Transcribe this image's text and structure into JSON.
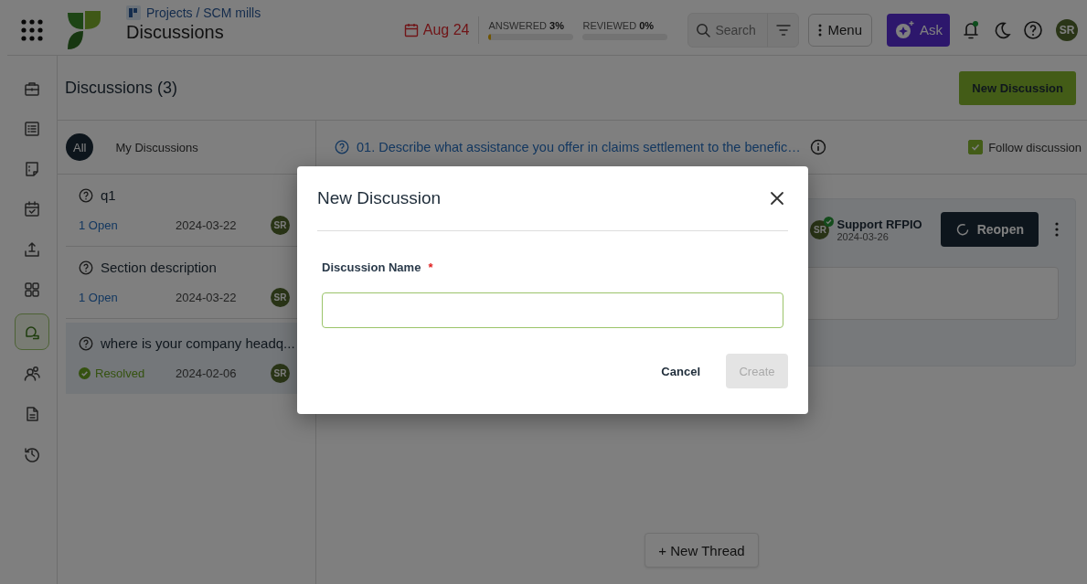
{
  "header": {
    "breadcrumb": "Projects / SCM mills",
    "title": "Discussions",
    "due": "Aug 24",
    "progress": [
      {
        "label": "ANSWERED",
        "value": "3%",
        "level": 0.03
      },
      {
        "label": "REVIEWED",
        "value": "0%",
        "level": 0
      }
    ],
    "search": {
      "placeholder": "Search"
    },
    "menu": "Menu",
    "ask": "Ask",
    "avatar": "SR"
  },
  "nav": [
    {
      "kind": "briefcase",
      "selected": false
    },
    {
      "kind": "list",
      "selected": false
    },
    {
      "kind": "note",
      "selected": false
    },
    {
      "kind": "calendar",
      "selected": false
    },
    {
      "kind": "upload",
      "selected": false
    },
    {
      "kind": "grid",
      "selected": false
    },
    {
      "kind": "chat",
      "selected": true
    },
    {
      "kind": "people",
      "selected": false
    },
    {
      "kind": "document",
      "selected": false
    },
    {
      "kind": "history",
      "selected": false
    }
  ],
  "discussions": {
    "heading": "Discussions (3)",
    "new_button": "New Discussion",
    "filters": [
      {
        "label": "All",
        "selected": true
      },
      {
        "label": "My Discussions",
        "selected": false
      }
    ],
    "items": [
      {
        "title": "q1",
        "status": "1 Open",
        "kind": "open",
        "date": "2024-03-22",
        "avatar": "SR",
        "selected": false
      },
      {
        "title": "Section description",
        "status": "1 Open",
        "kind": "open",
        "date": "2024-03-22",
        "avatar": "SR",
        "selected": false
      },
      {
        "title": "where is your company headq...",
        "status": "Resolved",
        "kind": "resolved",
        "date": "2024-02-06",
        "avatar": "SR",
        "selected": true
      }
    ]
  },
  "thread": {
    "question": "01. Describe what assistance you offer in claims settlement to the benefic…",
    "follow": {
      "label": "Follow discussion",
      "checked": true
    },
    "author": "Support RFPIO",
    "date": "2024-03-26",
    "avatar": "SR",
    "reopen": "Reopen",
    "new_thread": "+ New Thread"
  },
  "dialog": {
    "title": "New Discussion",
    "field_label": "Discussion Name",
    "required_mark": "*",
    "cancel": "Cancel",
    "create": {
      "label": "Create",
      "disabled": true
    }
  }
}
